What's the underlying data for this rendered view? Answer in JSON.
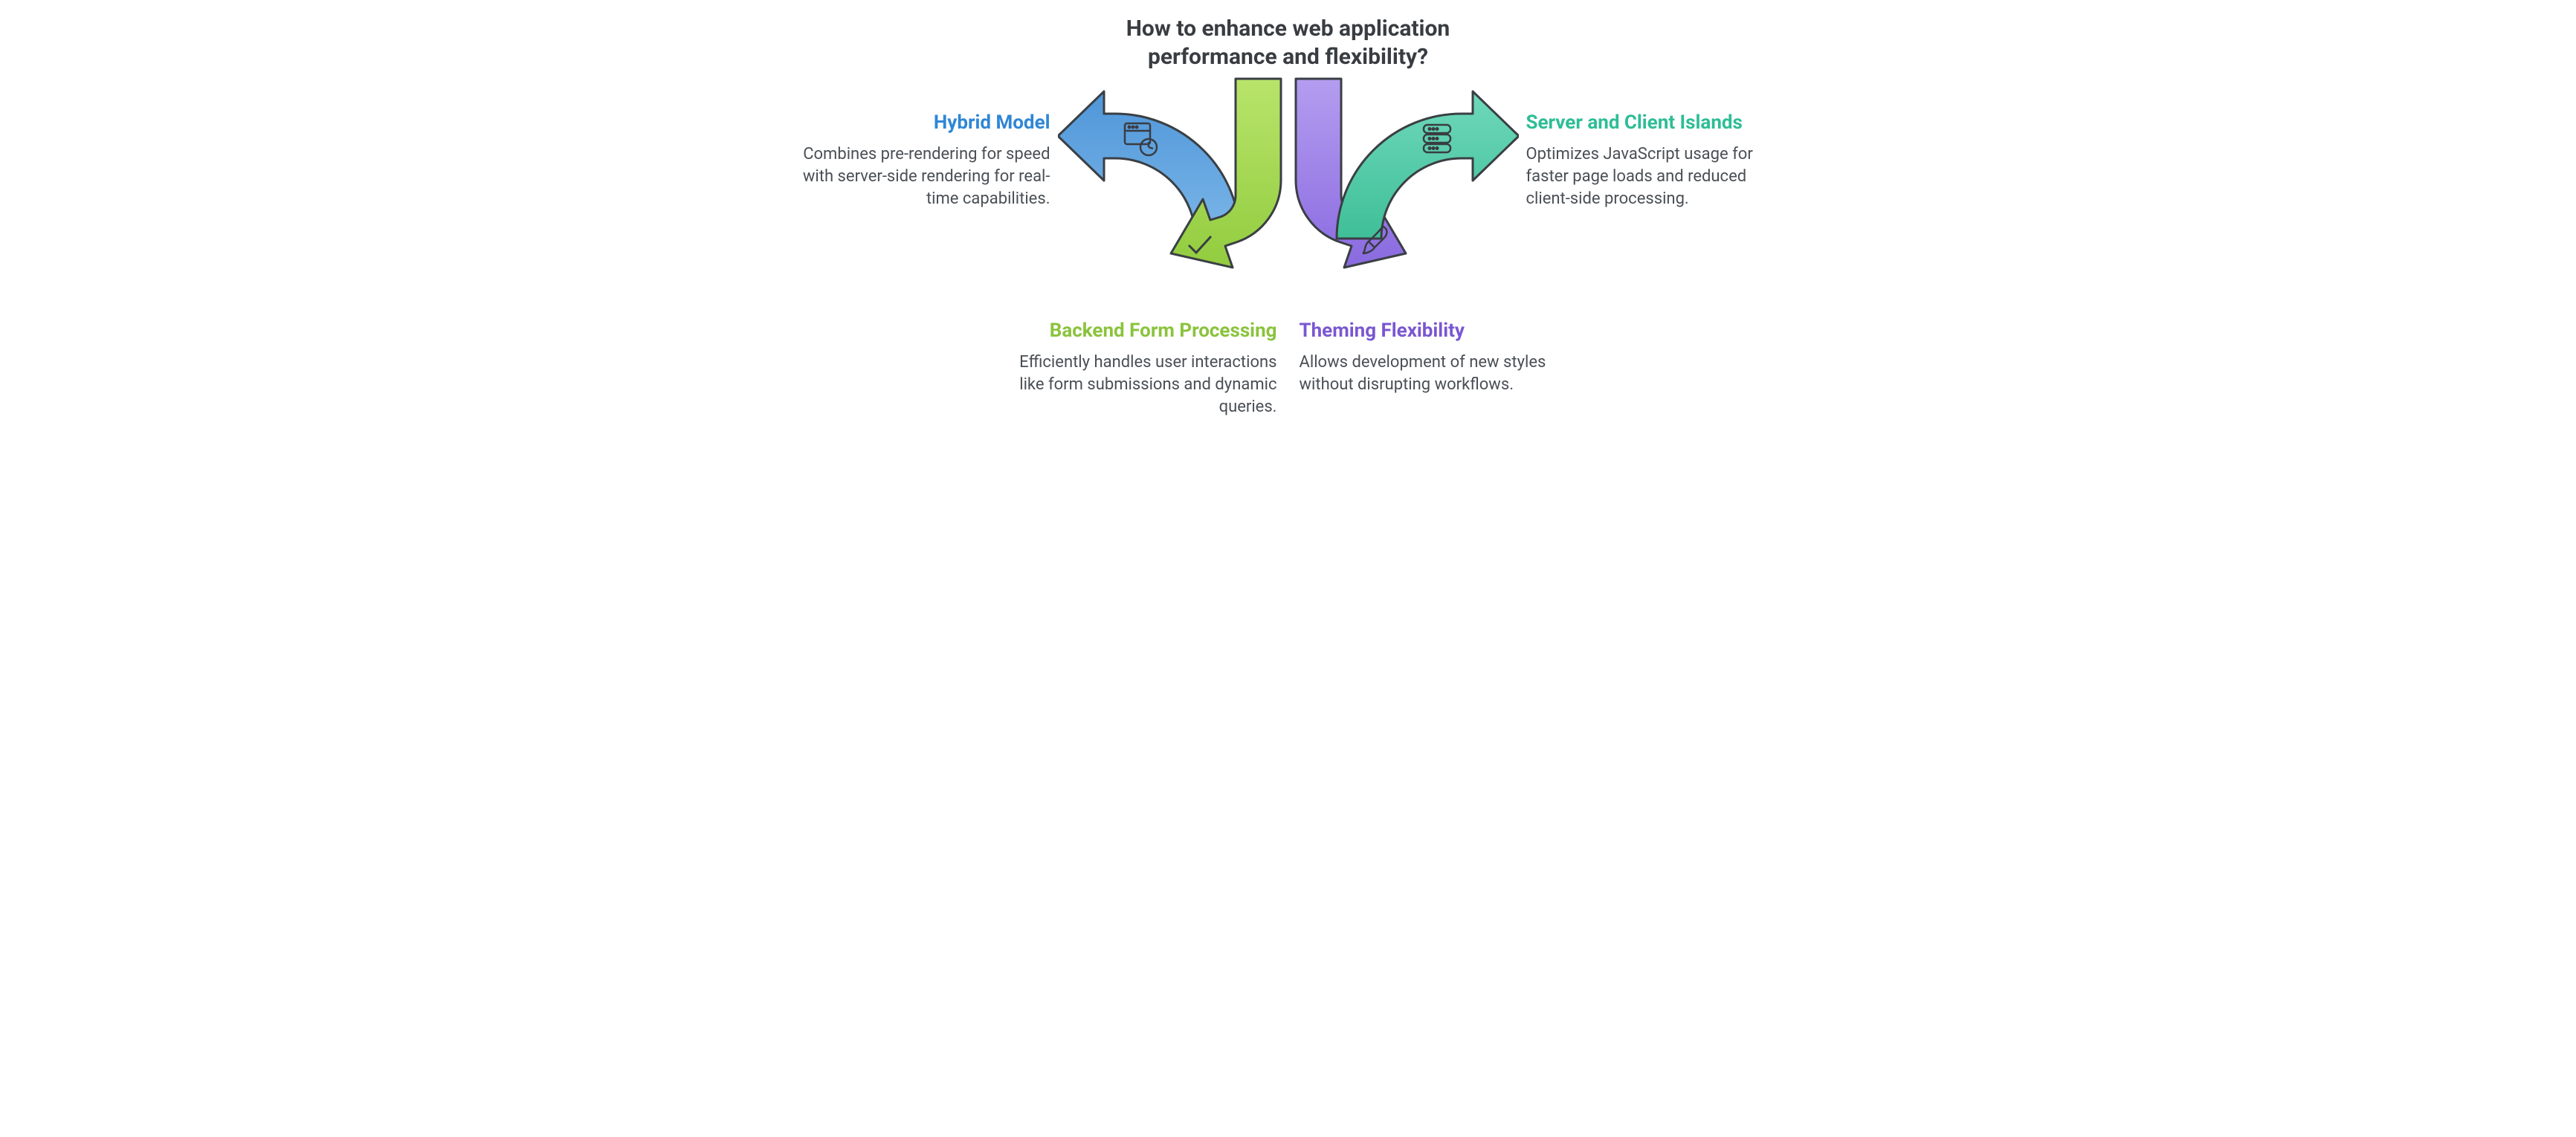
{
  "title": "How to enhance web application performance and flexibility?",
  "items": {
    "hybrid": {
      "heading": "Hybrid Model",
      "body": "Combines pre-rendering for speed with server-side rendering for real-time capabilities."
    },
    "islands": {
      "heading": "Server and Client Islands",
      "body": "Optimizes JavaScript usage for faster page loads and reduced client-side processing."
    },
    "backend": {
      "heading": "Backend Form Processing",
      "body": "Efficiently handles user interactions like form submissions and dynamic queries."
    },
    "theming": {
      "heading": "Theming Flexibility",
      "body": "Allows development of new styles without disrupting workflows."
    }
  },
  "colors": {
    "blue": "#5ba3e0",
    "green": "#a3d94f",
    "purple": "#9b7ee8",
    "teal": "#52c9a8",
    "stroke": "#3a3f44"
  }
}
